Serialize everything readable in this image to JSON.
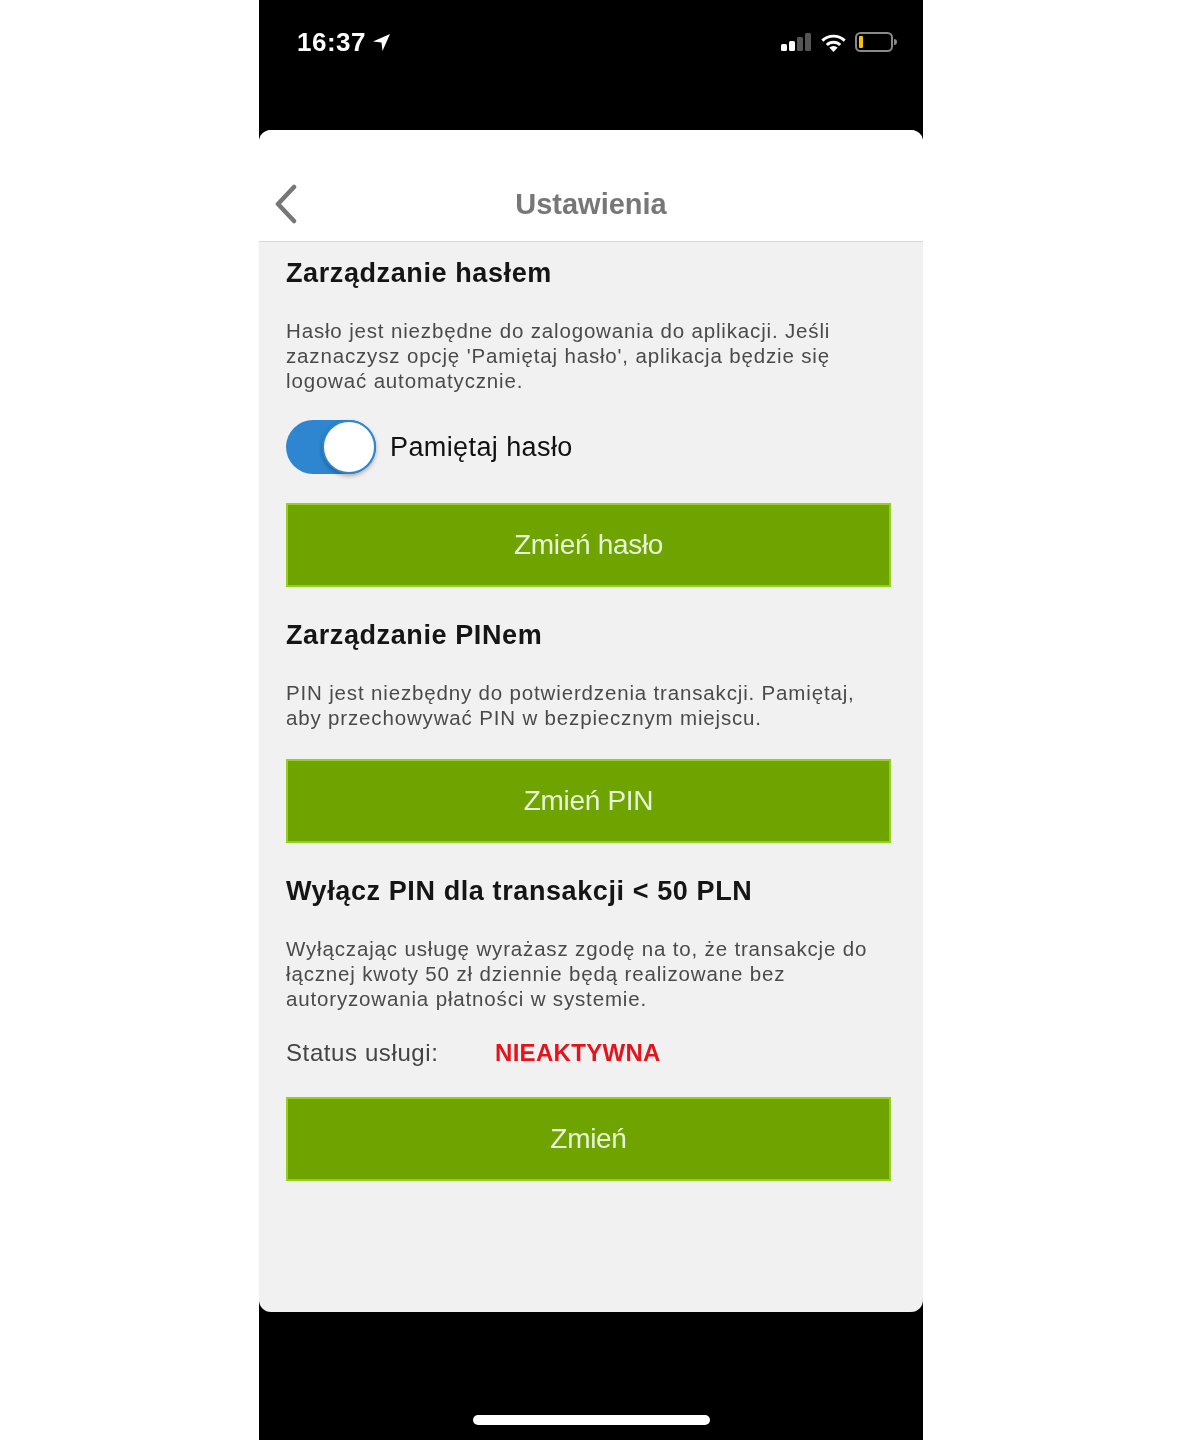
{
  "status_bar": {
    "time": "16:37"
  },
  "header": {
    "title": "Ustawienia"
  },
  "sections": [
    {
      "kind": "toggle",
      "heading": "Zarządzanie hasłem",
      "description": "Hasło jest niezbędne do zalogowania do aplikacji. Jeśli zaznaczysz opcję 'Pamiętaj hasło', aplikacja będzie się logować automatycznie.",
      "toggle": {
        "label": "Pamiętaj hasło",
        "on": true
      },
      "button": "Zmień hasło"
    },
    {
      "kind": "plain",
      "heading": "Zarządzanie PINem",
      "description": "PIN jest niezbędny do potwierdzenia transakcji. Pamiętaj, aby przechowywać PIN w bezpiecznym miejscu.",
      "button": "Zmień PIN"
    },
    {
      "kind": "status",
      "heading": "Wyłącz PIN dla transakcji < 50 PLN",
      "description": "Wyłączając usługę wyrażasz zgodę na to, że transakcje do łącznej kwoty 50 zł dziennie będą realizowane bez autoryzowania płatności w systemie.",
      "status": {
        "label": "Status usługi:",
        "value": "NIEAKTYWNA",
        "active": false
      },
      "button": "Zmień"
    }
  ]
}
